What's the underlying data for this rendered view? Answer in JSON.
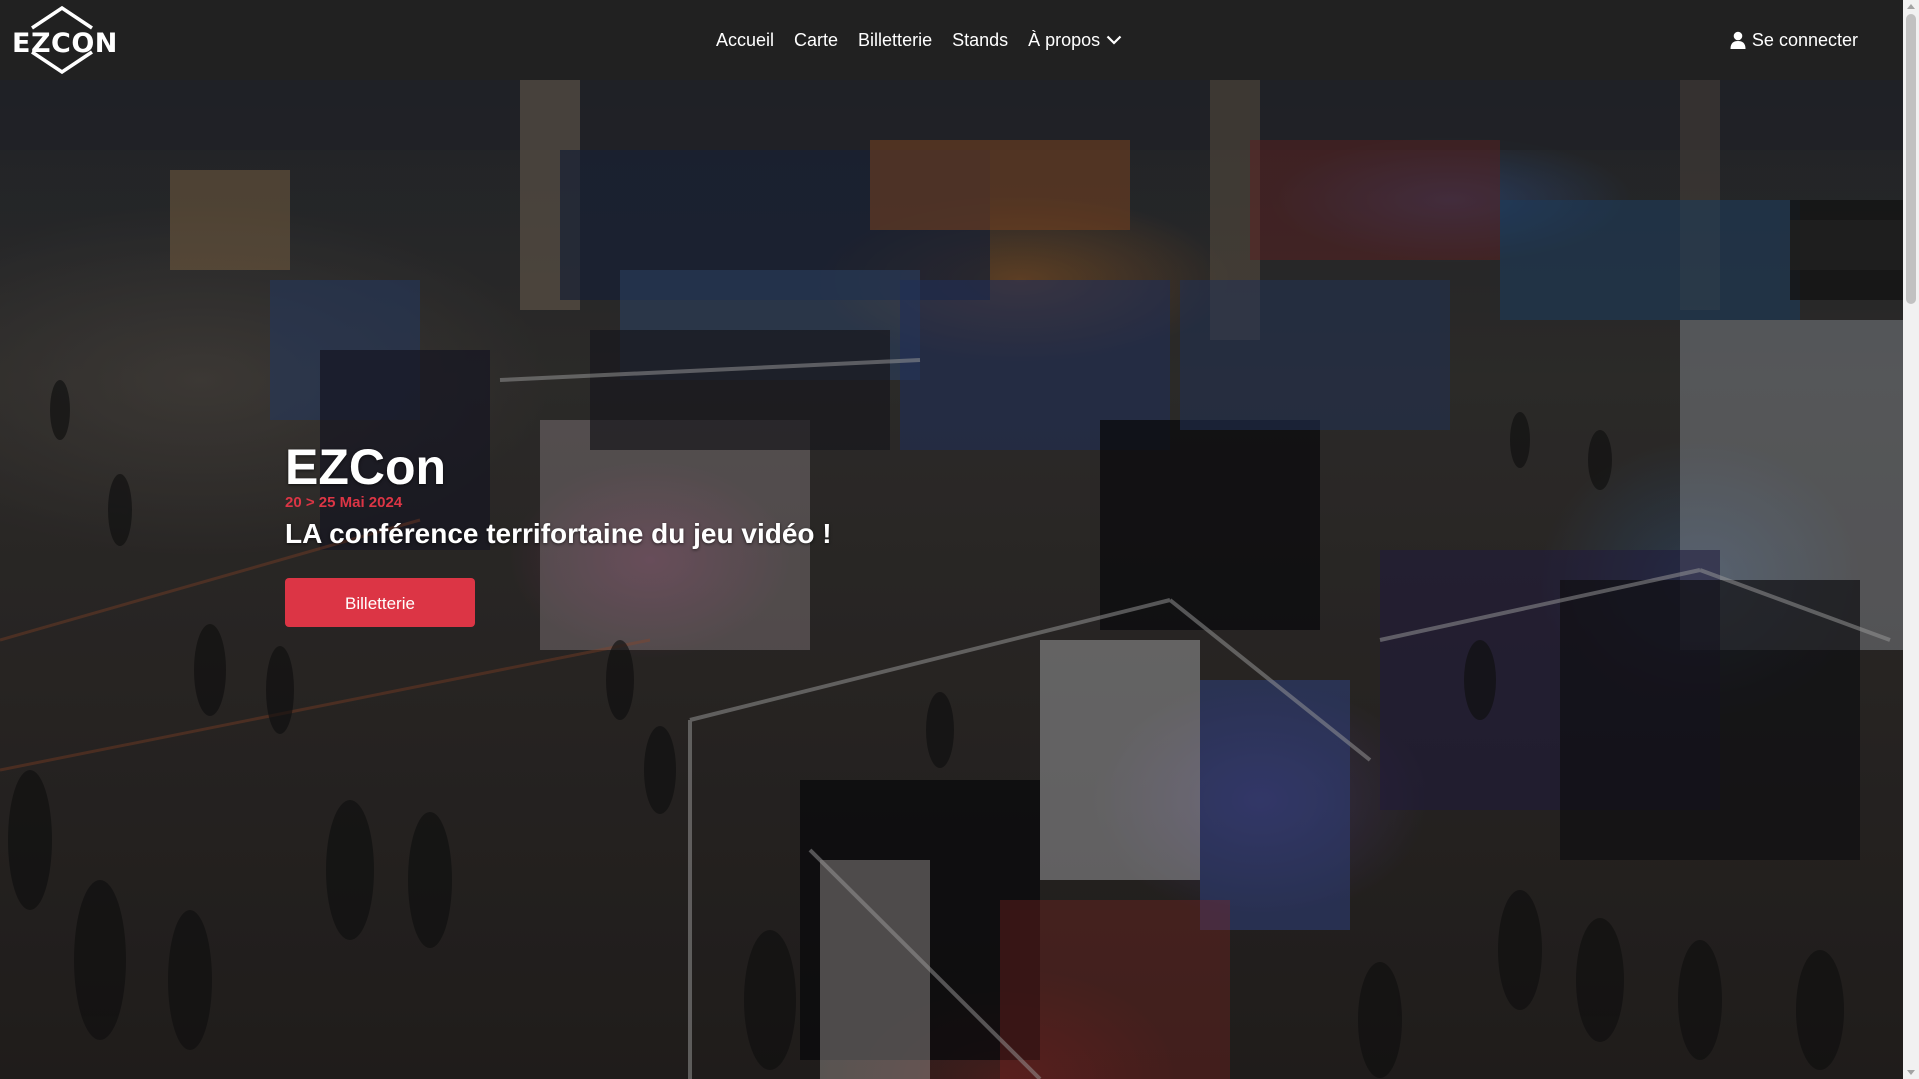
{
  "brand": {
    "logo_text": "EZCON"
  },
  "nav": {
    "items": [
      {
        "label": "Accueil"
      },
      {
        "label": "Carte"
      },
      {
        "label": "Billetterie"
      },
      {
        "label": "Stands"
      },
      {
        "label": "À propos"
      }
    ],
    "login_label": "Se connecter"
  },
  "hero": {
    "title": "EZCon",
    "date": "20 > 25 Mai 2024",
    "subtitle": "LA conférence terrifortaine du jeu vidéo !",
    "cta_label": "Billetterie"
  },
  "colors": {
    "navbar_bg": "#212121",
    "accent_red": "#dc3545",
    "text_white": "#ffffff"
  },
  "icons": {
    "logo": "diamond-logo-icon",
    "dropdown": "chevron-down-icon",
    "user": "user-icon"
  }
}
